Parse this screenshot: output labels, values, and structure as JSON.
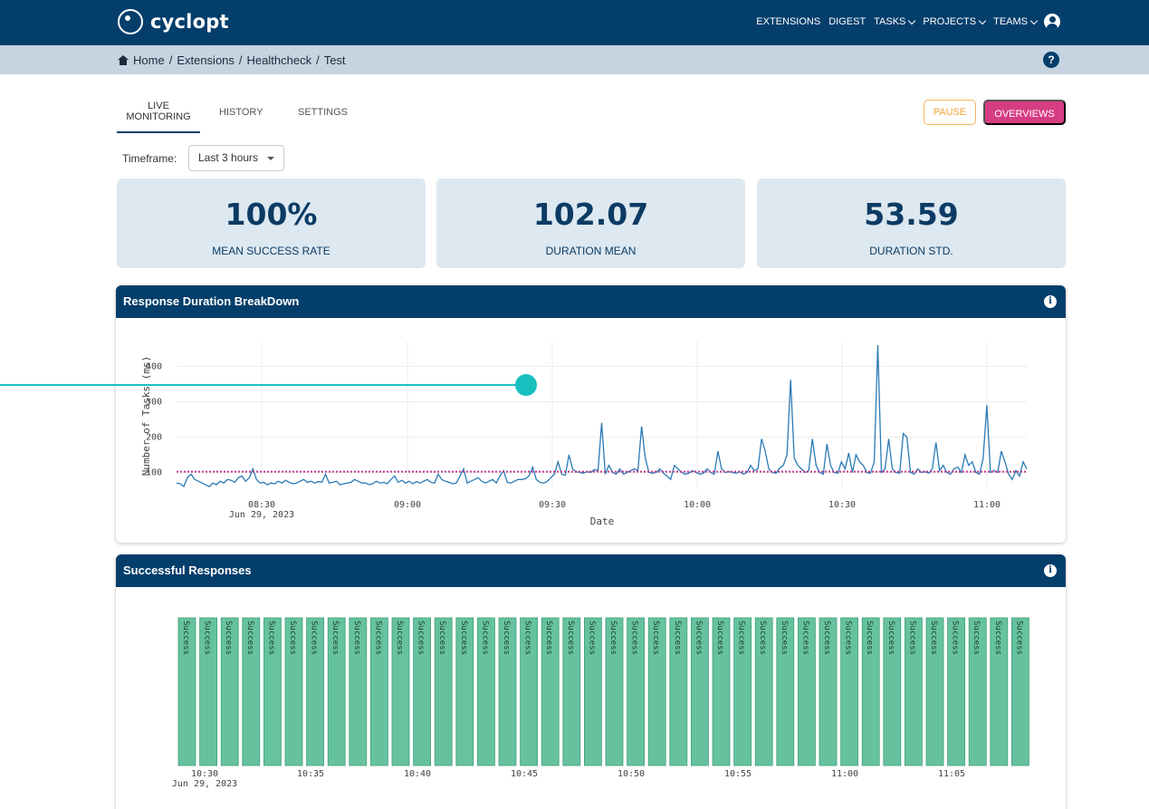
{
  "header": {
    "logo_text": "cyclopt",
    "nav": [
      {
        "label": "EXTENSIONS",
        "dropdown": false
      },
      {
        "label": "DIGEST",
        "dropdown": false
      },
      {
        "label": "TASKS",
        "dropdown": true
      },
      {
        "label": "PROJECTS",
        "dropdown": true
      },
      {
        "label": "TEAMS",
        "dropdown": true
      }
    ],
    "user_icon": "user-circle-icon"
  },
  "breadcrumb": {
    "items": [
      "Home",
      "Extensions",
      "Healthcheck",
      "Test"
    ],
    "separator": "/",
    "help": "?"
  },
  "tabs": {
    "live_line1": "LIVE",
    "live_line2": "MONITORING",
    "history": "HISTORY",
    "settings": "SETTINGS",
    "active": "live"
  },
  "actions": {
    "pause": "PAUSE",
    "overviews": "OVERVIEWS"
  },
  "timeframe": {
    "label": "Timeframe:",
    "value": "Last 3 hours"
  },
  "stats": [
    {
      "value": "100%",
      "label": "MEAN SUCCESS RATE"
    },
    {
      "value": "102.07",
      "label": "DURATION MEAN"
    },
    {
      "value": "53.59",
      "label": "DURATION STD."
    }
  ],
  "panels": {
    "duration_title": "Response Duration BreakDown",
    "success_title": "Successful Responses",
    "info_icon": "info-icon"
  },
  "colors": {
    "navy": "#043e6b",
    "accent_pink": "#d63c83",
    "pause_orange": "#f2a33a",
    "line_blue": "#2a7ab5",
    "mean_line": "#c2388f",
    "bar_green": "#66c29e"
  },
  "chart_data": [
    {
      "type": "line",
      "title": "",
      "xlabel": "Date",
      "ylabel": "Number of Tasks (ms)",
      "x_ticks": [
        "08:30",
        "09:00",
        "09:30",
        "10:00",
        "10:30",
        "11:00"
      ],
      "x_subtick": "Jun 29, 2023",
      "y_ticks": [
        100,
        200,
        300,
        400
      ],
      "ylim": [
        50,
        470
      ],
      "grid": true,
      "mean_line": 102.07,
      "series": [
        {
          "values": [
            70,
            68,
            60,
            85,
            95,
            80,
            75,
            70,
            65,
            60,
            70,
            65,
            75,
            70,
            80,
            78,
            72,
            85,
            90,
            75,
            85,
            110,
            80,
            70,
            72,
            65,
            70,
            68,
            75,
            70,
            78,
            72,
            68,
            70,
            75,
            80,
            72,
            75,
            70,
            74,
            72,
            95,
            70,
            72,
            75,
            65,
            68,
            70,
            72,
            80,
            75,
            70,
            70,
            65,
            68,
            75,
            70,
            72,
            68,
            80,
            90,
            72,
            78,
            70,
            75,
            68,
            74,
            70,
            75,
            80,
            72,
            70,
            95,
            80,
            75,
            72,
            68,
            70,
            90,
            110,
            70,
            75,
            80,
            85,
            75,
            70,
            75,
            80,
            70,
            90,
            105,
            72,
            70,
            75,
            80,
            80,
            82,
            90,
            115,
            80,
            72,
            70,
            74,
            85,
            95,
            130,
            95,
            92,
            150,
            110,
            102,
            100,
            98,
            102,
            100,
            108,
            105,
            240,
            95,
            120,
            100,
            95,
            110,
            95,
            100,
            105,
            110,
            105,
            230,
            140,
            100,
            98,
            100,
            110,
            98,
            90,
            80,
            120,
            110,
            100,
            95,
            98,
            105,
            100,
            95,
            98,
            110,
            100,
            95,
            160,
            110,
            100,
            102,
            100,
            98,
            102,
            95,
            100,
            120,
            105,
            110,
            195,
            160,
            110,
            100,
            98,
            112,
            120,
            150,
            362,
            140,
            120,
            110,
            100,
            105,
            195,
            120,
            100,
            95,
            180,
            120,
            100,
            98,
            130,
            110,
            155,
            100,
            150,
            130,
            120,
            100,
            98,
            130,
            460,
            100,
            110,
            195,
            110,
            100,
            98,
            210,
            200,
            100,
            95,
            110,
            100,
            102,
            98,
            110,
            185,
            105,
            120,
            100,
            95,
            110,
            115,
            100,
            150,
            120,
            130,
            100,
            95,
            140,
            290,
            100,
            105,
            100,
            160,
            130,
            95,
            80,
            105,
            90,
            130,
            110
          ]
        }
      ]
    },
    {
      "type": "bar",
      "title": "",
      "x_ticks": [
        "10:30",
        "10:35",
        "10:40",
        "10:45",
        "10:50",
        "10:55",
        "11:00",
        "11:05"
      ],
      "x_subtick": "Jun 29, 2023",
      "bar_label": "Success",
      "bar_count": 40,
      "values": [
        1,
        1,
        1,
        1,
        1,
        1,
        1,
        1,
        1,
        1,
        1,
        1,
        1,
        1,
        1,
        1,
        1,
        1,
        1,
        1,
        1,
        1,
        1,
        1,
        1,
        1,
        1,
        1,
        1,
        1,
        1,
        1,
        1,
        1,
        1,
        1,
        1,
        1,
        1,
        1
      ]
    }
  ]
}
